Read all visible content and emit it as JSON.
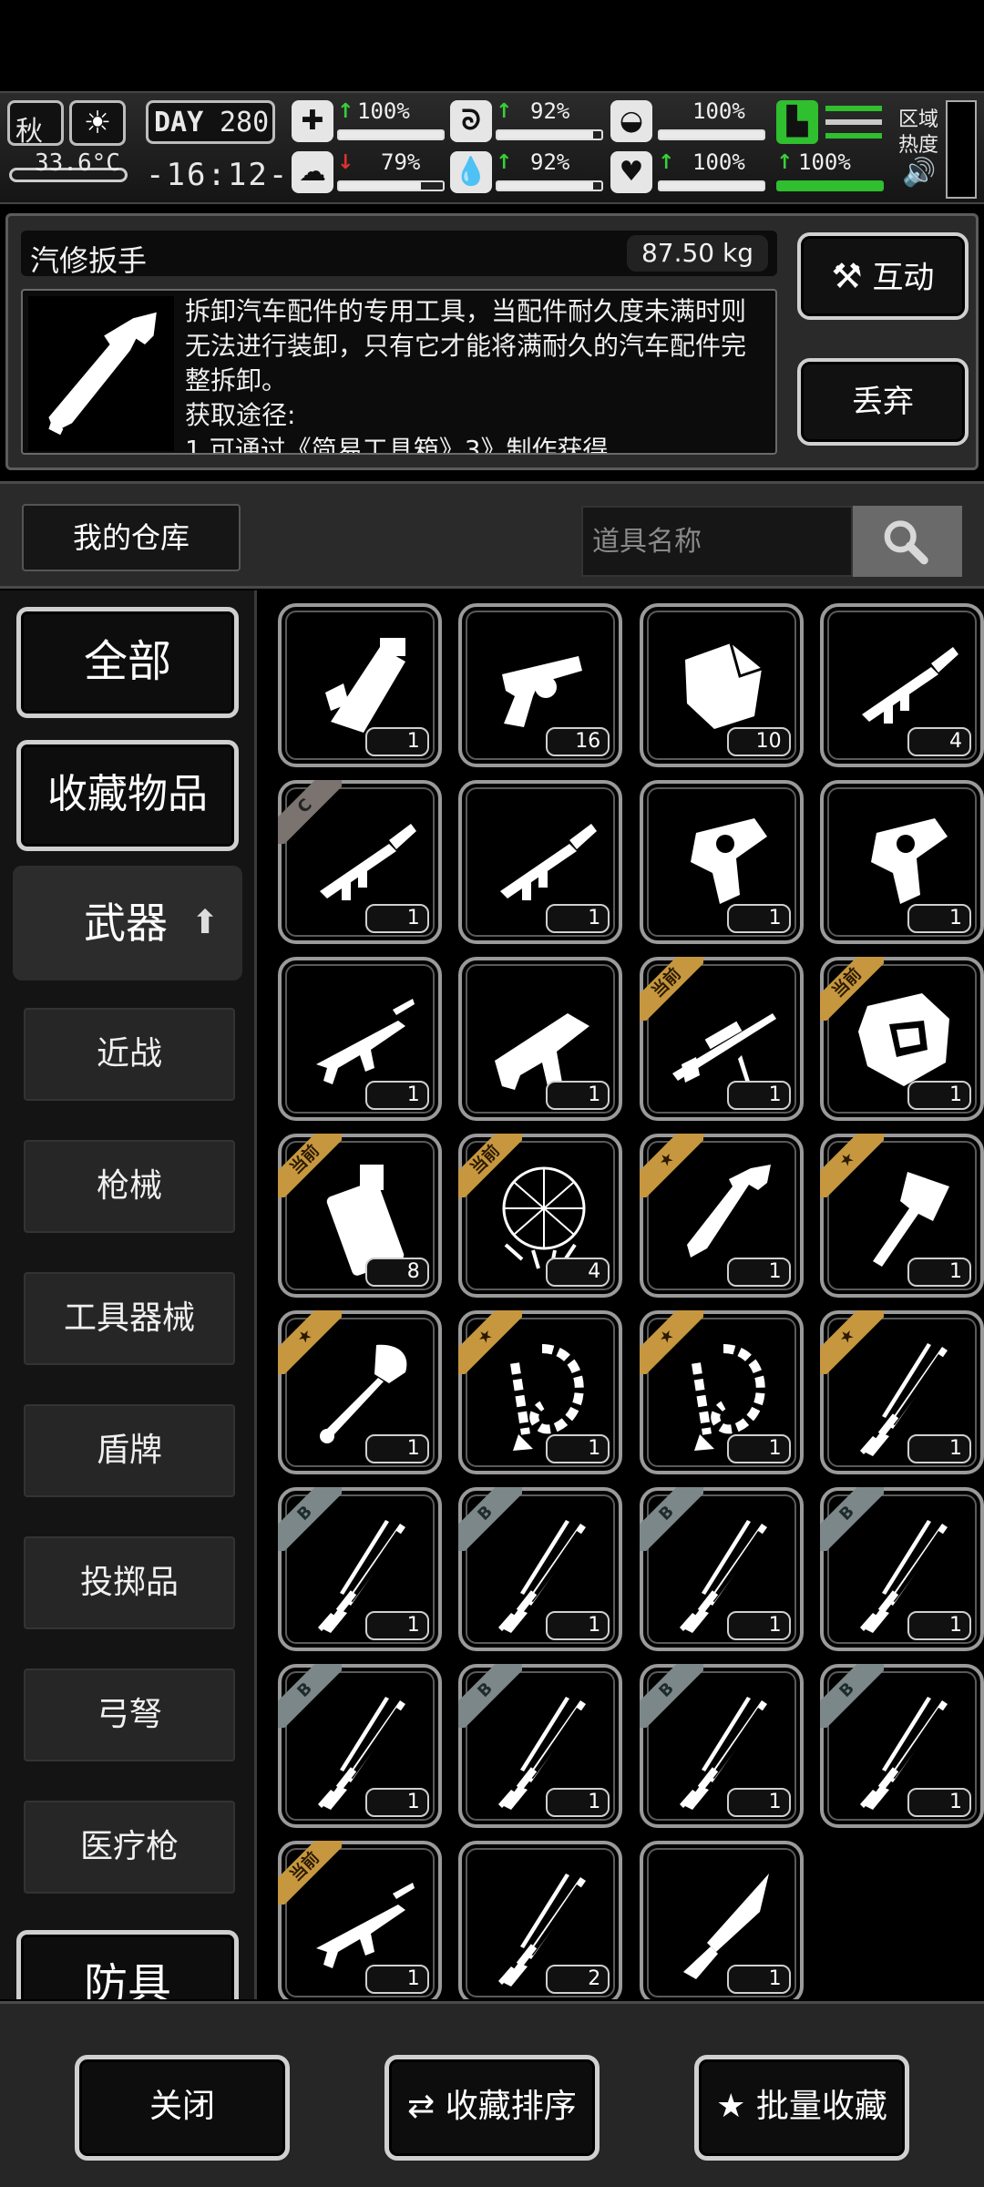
{
  "status": {
    "season": "秋",
    "temperature": "33.6°C",
    "day_label": "DAY",
    "day_number": "280",
    "time": "-16:12-",
    "stats": [
      {
        "icon": "medkit-icon",
        "trend": "up",
        "value": "100%",
        "fill": 1.0
      },
      {
        "icon": "stomach-icon",
        "trend": "up",
        "value": "92%",
        "fill": 0.92
      },
      {
        "icon": "bladder-icon",
        "trend": "none",
        "value": "100%",
        "fill": 1.0
      },
      {
        "icon": "brain-icon",
        "trend": "down",
        "value": "79%",
        "fill": 0.79
      },
      {
        "icon": "water-drop-icon",
        "trend": "up",
        "value": "92%",
        "fill": 0.92
      },
      {
        "icon": "heart-icon",
        "trend": "up",
        "value": "100%",
        "fill": 1.0
      }
    ],
    "stamina": {
      "trend": "up",
      "value": "100%"
    },
    "zone_label": "区域热度",
    "accent_green": "#2fbf2f"
  },
  "detail": {
    "name": "汽修扳手",
    "weight": "87.50 kg",
    "description": "拆卸汽车配件的专用工具，当配件耐久度未满时则无法进行装卸，只有它才能将满耐久的汽车配件完整拆卸。",
    "source_label": "获取途径:",
    "source_partial": "1.可通过《简易工具箱》3》制作获得",
    "interact_label": "互动",
    "discard_label": "丢弃"
  },
  "warehouse": {
    "title": "我的仓库",
    "search_placeholder": "道具名称"
  },
  "categories": {
    "all": "全部",
    "favorites": "收藏物品",
    "weapons": "武器",
    "sub": [
      "近战",
      "枪械",
      "工具器械",
      "盾牌",
      "投掷品",
      "弓弩",
      "医疗枪"
    ],
    "armor": "防具"
  },
  "items": [
    {
      "icon": "gatling-gun-icon",
      "qty": "1",
      "tag": ""
    },
    {
      "icon": "revolver-icon",
      "qty": "16",
      "tag": ""
    },
    {
      "icon": "stone-icon",
      "qty": "10",
      "tag": ""
    },
    {
      "icon": "rocket-launcher-icon",
      "qty": "4",
      "tag": ""
    },
    {
      "icon": "rocket-launcher-icon",
      "qty": "1",
      "tag": "C"
    },
    {
      "icon": "rocket-launcher-icon",
      "qty": "1",
      "tag": ""
    },
    {
      "icon": "flare-gun-icon",
      "qty": "1",
      "tag": ""
    },
    {
      "icon": "flare-gun-icon",
      "qty": "1",
      "tag": ""
    },
    {
      "icon": "assault-rifle-icon",
      "qty": "1",
      "tag": ""
    },
    {
      "icon": "grenade-launcher-icon",
      "qty": "1",
      "tag": ""
    },
    {
      "icon": "sniper-rifle-icon",
      "qty": "1",
      "tag": "当前"
    },
    {
      "icon": "shield-icon",
      "qty": "1",
      "tag": "当前"
    },
    {
      "icon": "medical-kit-icon",
      "qty": "8",
      "tag": "当前"
    },
    {
      "icon": "net-icon",
      "qty": "4",
      "tag": "当前"
    },
    {
      "icon": "wrench-icon",
      "qty": "1",
      "tag": "★"
    },
    {
      "icon": "axe-icon",
      "qty": "1",
      "tag": "★"
    },
    {
      "icon": "shovel-icon",
      "qty": "1",
      "tag": "★"
    },
    {
      "icon": "chain-whip-icon",
      "qty": "1",
      "tag": "★"
    },
    {
      "icon": "chain-whip-icon",
      "qty": "1",
      "tag": "★"
    },
    {
      "icon": "katana-icon",
      "qty": "1",
      "tag": "★"
    },
    {
      "icon": "katana-icon",
      "qty": "1",
      "tag": "B"
    },
    {
      "icon": "katana-icon",
      "qty": "1",
      "tag": "B"
    },
    {
      "icon": "katana-icon",
      "qty": "1",
      "tag": "B"
    },
    {
      "icon": "katana-icon",
      "qty": "1",
      "tag": "B"
    },
    {
      "icon": "katana-icon",
      "qty": "1",
      "tag": "B"
    },
    {
      "icon": "katana-icon",
      "qty": "1",
      "tag": "B"
    },
    {
      "icon": "katana-icon",
      "qty": "1",
      "tag": "B"
    },
    {
      "icon": "katana-icon",
      "qty": "1",
      "tag": "B"
    },
    {
      "icon": "assault-rifle-icon",
      "qty": "1",
      "tag": "当前"
    },
    {
      "icon": "katana-icon",
      "qty": "2",
      "tag": ""
    },
    {
      "icon": "knife-icon",
      "qty": "1",
      "tag": ""
    }
  ],
  "bottom": {
    "close": "关闭",
    "sort_favorites": "收藏排序",
    "batch_favorite": "批量收藏"
  }
}
